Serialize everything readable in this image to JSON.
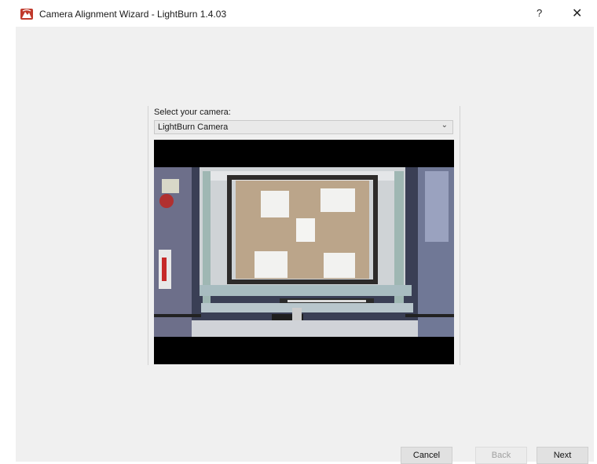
{
  "window": {
    "title": "Camera Alignment Wizard - LightBurn 1.4.03",
    "help_label": "?",
    "close_label": "✕"
  },
  "camera": {
    "label": "Select your camera:",
    "selected": "LightBurn Camera"
  },
  "buttons": {
    "cancel": "Cancel",
    "back": "Back",
    "next": "Next"
  }
}
